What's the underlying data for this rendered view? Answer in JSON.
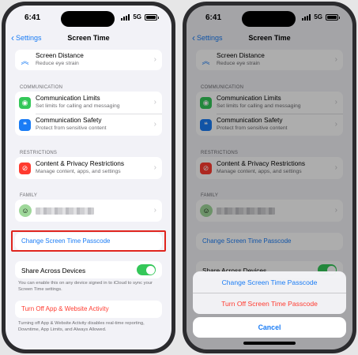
{
  "status": {
    "time": "6:41",
    "network": "5G"
  },
  "nav": {
    "back_label": "Settings",
    "title": "Screen Time"
  },
  "rows": {
    "screen_distance": {
      "title": "Screen Distance",
      "subtitle": "Reduce eye strain"
    },
    "communication_header": "COMMUNICATION",
    "communication_limits": {
      "title": "Communication Limits",
      "subtitle": "Set limits for calling and messaging"
    },
    "communication_safety": {
      "title": "Communication Safety",
      "subtitle": "Protect from sensitive content"
    },
    "restrictions_header": "RESTRICTIONS",
    "content_privacy": {
      "title": "Content & Privacy Restrictions",
      "subtitle": "Manage content, apps, and settings"
    },
    "family_header": "FAMILY",
    "change_passcode": "Change Screen Time Passcode",
    "share_across": "Share Across Devices",
    "share_footer": "You can enable this on any device signed in to iCloud to sync your Screen Time settings.",
    "turn_off": "Turn Off App & Website Activity",
    "turn_off_footer": "Turning off App & Website Activity disables real-time reporting, Downtime, App Limits, and Always Allowed."
  },
  "action_sheet": {
    "change_passcode": "Change Screen Time Passcode",
    "turn_off_passcode": "Turn Off Screen Time Passcode",
    "cancel": "Cancel"
  },
  "colors": {
    "accent": "#1a7cf5",
    "destructive": "#ff3b30",
    "toggle_on": "#34c759",
    "highlight_box": "#e0251e"
  },
  "icons": {
    "screen_distance": "double-chevron-up-icon",
    "communication_limits": "person-circle-icon",
    "communication_safety": "chat-bubbles-icon",
    "content_privacy": "no-entry-icon",
    "family": "memoji-avatar-icon"
  }
}
